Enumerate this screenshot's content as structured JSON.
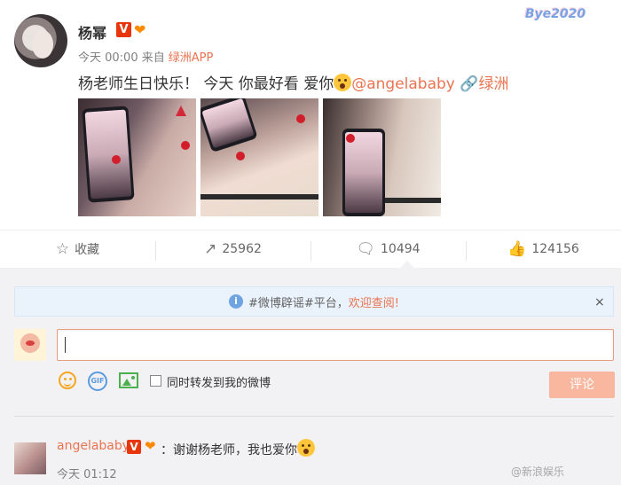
{
  "post": {
    "username": "杨幂",
    "verified_badge": "V",
    "time": "今天 00:00",
    "from_label": "来自",
    "source": "绿洲APP",
    "text_main": "杨老师生日快乐！ 今天 你最好看 爱你",
    "mention": "@angelababy",
    "location": "绿洲",
    "top_watermark": "Bye2020"
  },
  "actions": {
    "favorite": {
      "label": "收藏"
    },
    "repost": {
      "count": "25962"
    },
    "comment": {
      "count": "10494"
    },
    "like": {
      "count": "124156"
    }
  },
  "notice": {
    "prefix": "#微博辟谣#平台，",
    "highlight": "欢迎查阅!",
    "close": "×"
  },
  "composer": {
    "repost_checkbox_label": "同时转发到我的微博",
    "submit_label": "评论",
    "gif_label": "GIF"
  },
  "comment": {
    "username": "angelababy",
    "verified_badge": "V",
    "text": "：谢谢杨老师，我也爱你",
    "time": "今天 01:12",
    "watermark": "@新浪娱乐"
  }
}
